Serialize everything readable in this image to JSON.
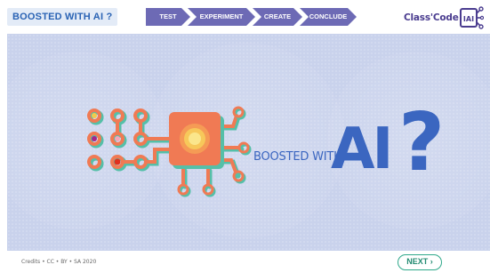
{
  "header": {
    "title": "BOOSTED WITH AI ?",
    "steps": [
      {
        "label": "TEST"
      },
      {
        "label": "EXPERIMENT"
      },
      {
        "label": "CREATE"
      },
      {
        "label": "CONCLUDE"
      }
    ],
    "logo_text": "Class'Code",
    "logo_badge": "IAI"
  },
  "stage": {
    "caption": "BOOSTED WITH",
    "ai_text": "AI",
    "question_mark": "?"
  },
  "footer": {
    "credits": "Credits • CC • BY • SA 2020",
    "next_label": "NEXT ›"
  },
  "colors": {
    "accent": "#6d6ab5",
    "brand_blue": "#3b66c0",
    "next_green": "#2fa88a",
    "circuit_orange": "#f07a54",
    "circuit_teal": "#55bfa8",
    "stage_bg": "#c9d2ec"
  },
  "icons": {
    "circuit": "circuit-chip-icon",
    "logo": "circuit-logo-icon"
  }
}
